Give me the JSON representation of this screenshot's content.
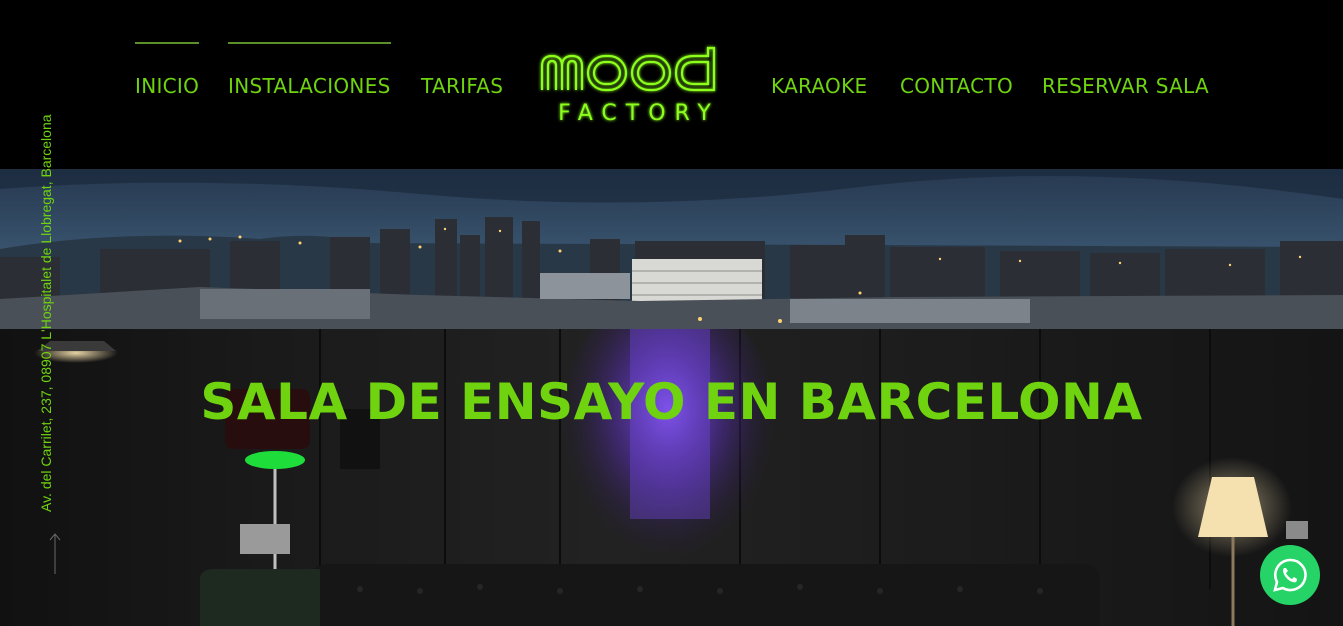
{
  "nav": {
    "left": [
      {
        "label": "INICIO",
        "active": true
      },
      {
        "label": "INSTALACIONES",
        "active": true
      },
      {
        "label": "TARIFAS",
        "active": false
      }
    ],
    "right": [
      {
        "label": "KARAOKE",
        "active": false
      },
      {
        "label": "CONTACTO",
        "active": false
      },
      {
        "label": "RESERVAR SALA",
        "active": false
      }
    ]
  },
  "logo": {
    "word_top": "mood",
    "word_bottom": "FACTORY"
  },
  "sidebar": {
    "address": "Av. del Carrilet, 237, 08907 L'Hospitalet de Llobregat, Barcelona",
    "arrow_icon": "arrow-up-icon"
  },
  "hero": {
    "title": "SALA DE ENSAYO EN BARCELONA"
  },
  "chat": {
    "icon": "whatsapp-icon"
  },
  "colors": {
    "accent": "#6fd40f",
    "background": "#000000",
    "whatsapp": "#25d366"
  }
}
